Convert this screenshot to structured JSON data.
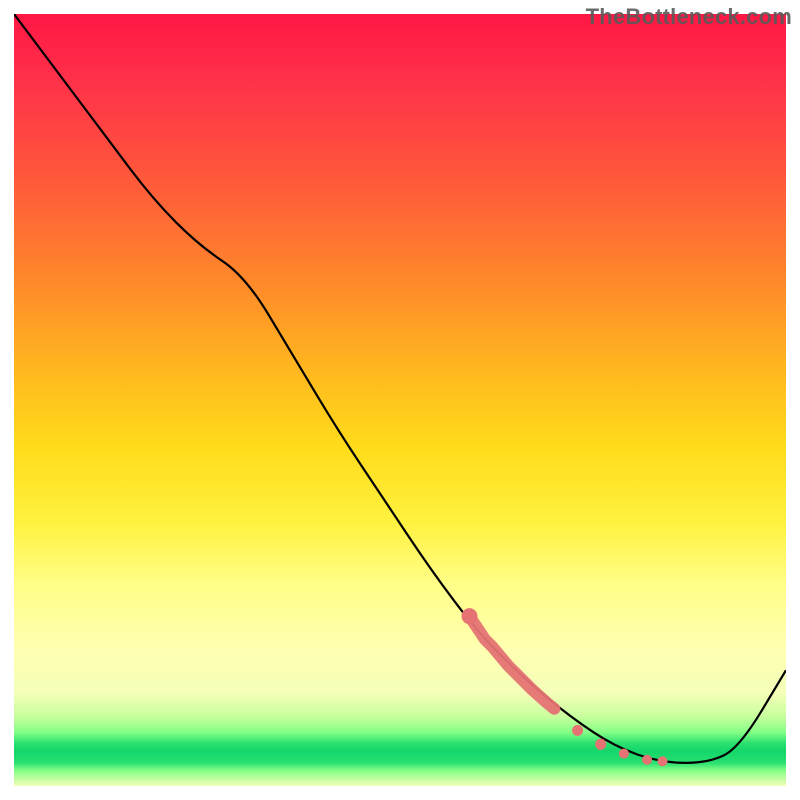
{
  "watermark": "TheBottleneck.com",
  "chart_data": {
    "type": "line",
    "title": "",
    "xlabel": "",
    "ylabel": "",
    "xlim": [
      0,
      100
    ],
    "ylim": [
      0,
      100
    ],
    "grid": false,
    "gradient_bands": [
      {
        "name": "red",
        "approx_y_range": [
          75,
          100
        ]
      },
      {
        "name": "orange",
        "approx_y_range": [
          50,
          75
        ]
      },
      {
        "name": "yellow",
        "approx_y_range": [
          20,
          50
        ]
      },
      {
        "name": "green",
        "approx_y_range": [
          3,
          8
        ]
      }
    ],
    "series": [
      {
        "name": "bottleneck-curve",
        "x": [
          0,
          6,
          12,
          18,
          24,
          30,
          36,
          42,
          48,
          54,
          60,
          66,
          72,
          78,
          84,
          90,
          94,
          100
        ],
        "y": [
          100,
          92,
          84,
          76,
          70,
          66,
          56,
          46,
          37,
          28,
          20,
          14,
          9,
          5,
          3,
          3,
          5,
          15
        ],
        "color": "#000000"
      }
    ],
    "highlight_points": {
      "name": "highlighted-segment",
      "color": "#e57373",
      "points_xy": [
        [
          59,
          22
        ],
        [
          60,
          20.5
        ],
        [
          61,
          19
        ],
        [
          62,
          18
        ],
        [
          63,
          16.8
        ],
        [
          64,
          15.6
        ],
        [
          65,
          14.6
        ],
        [
          66,
          13.6
        ],
        [
          67,
          12.6
        ],
        [
          68,
          11.7
        ],
        [
          69,
          10.8
        ],
        [
          70,
          10
        ],
        [
          73,
          7.2
        ],
        [
          76,
          5.4
        ],
        [
          79,
          4.2
        ],
        [
          82,
          3.4
        ],
        [
          84,
          3.2
        ]
      ]
    }
  }
}
